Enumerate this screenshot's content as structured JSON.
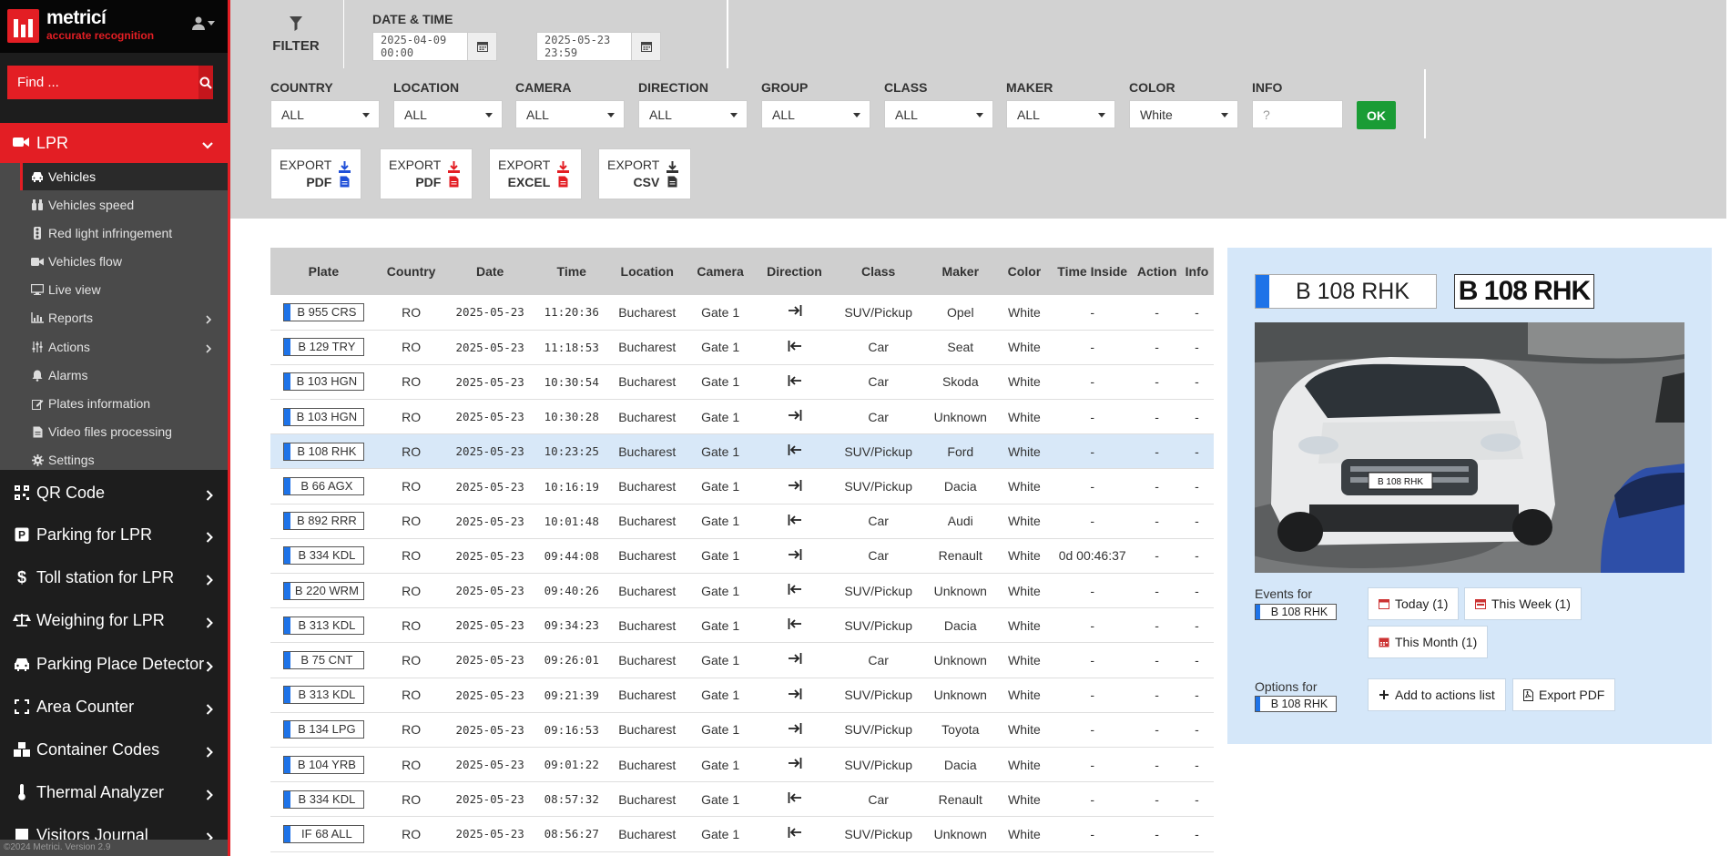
{
  "brand": {
    "name": "metricí",
    "tagline": "accurate recognition"
  },
  "search": {
    "placeholder": "Find ..."
  },
  "sidebar": {
    "lpr_label": "LPR",
    "lpr_items": [
      {
        "label": "Vehicles",
        "icon": "car-icon"
      },
      {
        "label": "Vehicles speed",
        "icon": "binoculars-icon"
      },
      {
        "label": "Red light infringement",
        "icon": "traffic-light-icon"
      },
      {
        "label": "Vehicles flow",
        "icon": "video-icon"
      },
      {
        "label": "Live view",
        "icon": "monitor-icon"
      },
      {
        "label": "Reports",
        "icon": "chart-icon"
      },
      {
        "label": "Actions",
        "icon": "sliders-icon"
      },
      {
        "label": "Alarms",
        "icon": "bell-icon"
      },
      {
        "label": "Plates information",
        "icon": "edit-icon"
      },
      {
        "label": "Video files processing",
        "icon": "file-icon"
      },
      {
        "label": "Settings",
        "icon": "gear-icon"
      }
    ],
    "modules": [
      {
        "label": "QR Code",
        "icon": "qr-icon"
      },
      {
        "label": "Parking for LPR",
        "icon": "parking-icon"
      },
      {
        "label": "Toll station for LPR",
        "icon": "dollar-icon"
      },
      {
        "label": "Weighing for LPR",
        "icon": "scale-icon"
      },
      {
        "label": "Parking Place Detector",
        "icon": "car-front-icon"
      },
      {
        "label": "Area Counter",
        "icon": "expand-icon"
      },
      {
        "label": "Container Codes",
        "icon": "boxes-icon"
      },
      {
        "label": "Thermal Analyzer",
        "icon": "thermometer-icon"
      },
      {
        "label": "Visitors Journal",
        "icon": "book-icon"
      }
    ],
    "version": "©2024 Metrici. Version 2.9"
  },
  "filter": {
    "title": "FILTER",
    "datetime_label": "DATE & TIME",
    "date_from": "2025-04-09 00:00",
    "date_to": "2025-05-23 23:59",
    "fields": [
      {
        "label": "COUNTRY",
        "value": "ALL"
      },
      {
        "label": "LOCATION",
        "value": "ALL"
      },
      {
        "label": "CAMERA",
        "value": "ALL"
      },
      {
        "label": "DIRECTION",
        "value": "ALL"
      },
      {
        "label": "GROUP",
        "value": "ALL"
      },
      {
        "label": "CLASS",
        "value": "ALL"
      },
      {
        "label": "MAKER",
        "value": "ALL"
      },
      {
        "label": "COLOR",
        "value": "White"
      }
    ],
    "info_label": "INFO",
    "info_placeholder": "?",
    "ok_label": "OK",
    "exports": [
      {
        "top": "EXPORT",
        "bottom": "PDF",
        "color": "#1f4fd8"
      },
      {
        "top": "EXPORT",
        "bottom": "PDF",
        "color": "#e31e24"
      },
      {
        "top": "EXPORT",
        "bottom": "EXCEL",
        "color": "#e31e24"
      },
      {
        "top": "EXPORT",
        "bottom": "CSV",
        "color": "#333333"
      }
    ]
  },
  "table": {
    "headers": [
      "Plate",
      "Country",
      "Date",
      "Time",
      "Location",
      "Camera",
      "Direction",
      "Class",
      "Maker",
      "Color",
      "Time Inside",
      "Action",
      "Info"
    ],
    "rows": [
      {
        "plate": "B 955 CRS",
        "country": "RO",
        "date": "2025-05-23",
        "time": "11:20:36",
        "location": "Bucharest",
        "camera": "Gate 1",
        "dir": "in",
        "class": "SUV/Pickup",
        "maker": "Opel",
        "color": "White",
        "inside": "-",
        "action": "-",
        "info": "-"
      },
      {
        "plate": "B 129 TRY",
        "country": "RO",
        "date": "2025-05-23",
        "time": "11:18:53",
        "location": "Bucharest",
        "camera": "Gate 1",
        "dir": "out",
        "class": "Car",
        "maker": "Seat",
        "color": "White",
        "inside": "-",
        "action": "-",
        "info": "-"
      },
      {
        "plate": "B 103 HGN",
        "country": "RO",
        "date": "2025-05-23",
        "time": "10:30:54",
        "location": "Bucharest",
        "camera": "Gate 1",
        "dir": "out",
        "class": "Car",
        "maker": "Skoda",
        "color": "White",
        "inside": "-",
        "action": "-",
        "info": "-"
      },
      {
        "plate": "B 103 HGN",
        "country": "RO",
        "date": "2025-05-23",
        "time": "10:30:28",
        "location": "Bucharest",
        "camera": "Gate 1",
        "dir": "in",
        "class": "Car",
        "maker": "Unknown",
        "color": "White",
        "inside": "-",
        "action": "-",
        "info": "-"
      },
      {
        "plate": "B 108 RHK",
        "country": "RO",
        "date": "2025-05-23",
        "time": "10:23:25",
        "location": "Bucharest",
        "camera": "Gate 1",
        "dir": "out",
        "class": "SUV/Pickup",
        "maker": "Ford",
        "color": "White",
        "inside": "-",
        "action": "-",
        "info": "-",
        "selected": true
      },
      {
        "plate": "B 66 AGX",
        "country": "RO",
        "date": "2025-05-23",
        "time": "10:16:19",
        "location": "Bucharest",
        "camera": "Gate 1",
        "dir": "in",
        "class": "SUV/Pickup",
        "maker": "Dacia",
        "color": "White",
        "inside": "-",
        "action": "-",
        "info": "-"
      },
      {
        "plate": "B 892 RRR",
        "country": "RO",
        "date": "2025-05-23",
        "time": "10:01:48",
        "location": "Bucharest",
        "camera": "Gate 1",
        "dir": "out",
        "class": "Car",
        "maker": "Audi",
        "color": "White",
        "inside": "-",
        "action": "-",
        "info": "-"
      },
      {
        "plate": "B 334 KDL",
        "country": "RO",
        "date": "2025-05-23",
        "time": "09:44:08",
        "location": "Bucharest",
        "camera": "Gate 1",
        "dir": "in",
        "class": "Car",
        "maker": "Renault",
        "color": "White",
        "inside": "0d 00:46:37",
        "action": "-",
        "info": "-"
      },
      {
        "plate": "B 220 WRM",
        "country": "RO",
        "date": "2025-05-23",
        "time": "09:40:26",
        "location": "Bucharest",
        "camera": "Gate 1",
        "dir": "out",
        "class": "SUV/Pickup",
        "maker": "Unknown",
        "color": "White",
        "inside": "-",
        "action": "-",
        "info": "-"
      },
      {
        "plate": "B 313 KDL",
        "country": "RO",
        "date": "2025-05-23",
        "time": "09:34:23",
        "location": "Bucharest",
        "camera": "Gate 1",
        "dir": "out",
        "class": "SUV/Pickup",
        "maker": "Dacia",
        "color": "White",
        "inside": "-",
        "action": "-",
        "info": "-"
      },
      {
        "plate": "B 75 CNT",
        "country": "RO",
        "date": "2025-05-23",
        "time": "09:26:01",
        "location": "Bucharest",
        "camera": "Gate 1",
        "dir": "in",
        "class": "Car",
        "maker": "Unknown",
        "color": "White",
        "inside": "-",
        "action": "-",
        "info": "-"
      },
      {
        "plate": "B 313 KDL",
        "country": "RO",
        "date": "2025-05-23",
        "time": "09:21:39",
        "location": "Bucharest",
        "camera": "Gate 1",
        "dir": "in",
        "class": "SUV/Pickup",
        "maker": "Unknown",
        "color": "White",
        "inside": "-",
        "action": "-",
        "info": "-"
      },
      {
        "plate": "B 134 LPG",
        "country": "RO",
        "date": "2025-05-23",
        "time": "09:16:53",
        "location": "Bucharest",
        "camera": "Gate 1",
        "dir": "in",
        "class": "SUV/Pickup",
        "maker": "Toyota",
        "color": "White",
        "inside": "-",
        "action": "-",
        "info": "-"
      },
      {
        "plate": "B 104 YRB",
        "country": "RO",
        "date": "2025-05-23",
        "time": "09:01:22",
        "location": "Bucharest",
        "camera": "Gate 1",
        "dir": "in",
        "class": "SUV/Pickup",
        "maker": "Dacia",
        "color": "White",
        "inside": "-",
        "action": "-",
        "info": "-"
      },
      {
        "plate": "B 334 KDL",
        "country": "RO",
        "date": "2025-05-23",
        "time": "08:57:32",
        "location": "Bucharest",
        "camera": "Gate 1",
        "dir": "out",
        "class": "Car",
        "maker": "Renault",
        "color": "White",
        "inside": "-",
        "action": "-",
        "info": "-"
      },
      {
        "plate": "IF 68 ALL",
        "country": "RO",
        "date": "2025-05-23",
        "time": "08:56:27",
        "location": "Bucharest",
        "camera": "Gate 1",
        "dir": "out",
        "class": "SUV/Pickup",
        "maker": "Unknown",
        "color": "White",
        "inside": "-",
        "action": "-",
        "info": "-"
      }
    ]
  },
  "details": {
    "plate": "B 108 RHK",
    "plate_crop": "B 108 RHK",
    "vehicle_plate_text": "B 108 RHK",
    "events_label": "Events for",
    "options_label": "Options for",
    "today": "Today (1)",
    "week": "This Week (1)",
    "month": "This Month (1)",
    "add_actions": "Add to actions list",
    "export_pdf": "Export PDF"
  },
  "colors": {
    "accent": "#e31e24",
    "ok": "#1a9c35",
    "plate_blue": "#1e73e8",
    "selected_row": "#d8e8f8",
    "details_bg": "#d5e7f9"
  }
}
